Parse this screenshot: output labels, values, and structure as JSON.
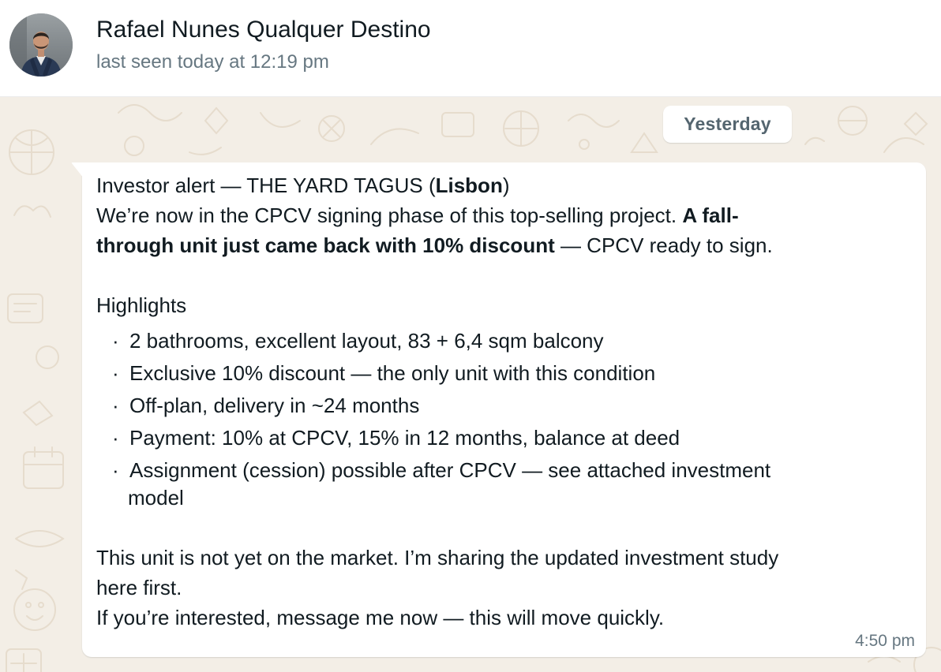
{
  "header": {
    "contact_name": "Rafael Nunes Qualquer Destino",
    "status": "last seen today at 12:19 pm"
  },
  "chat": {
    "date_divider": "Yesterday",
    "message": {
      "line1_a": "Investor alert — THE YARD TAGUS (",
      "line1_bold": "Lisbon",
      "line1_b": ")",
      "line2_a": "We’re now in the CPCV signing phase of this top-selling project. ",
      "line2_bold": "A fall-",
      "line3_bold": "through unit just came back with 10% discount",
      "line3_b": " — CPCV ready to sign.",
      "highlights_heading": "Highlights",
      "bullet_symbol": "·",
      "bullets": [
        "2 bathrooms, excellent layout, 83 + 6,4 sqm balcony",
        "Exclusive 10% discount — the only unit with this condition",
        "Off-plan, delivery in ~24 months",
        "Payment: 10% at CPCV, 15% in 12 months, balance at deed",
        "Assignment (cession) possible after CPCV — see attached investment"
      ],
      "bullet5_cont": "model",
      "closing1": "This unit is not yet on the market. I’m sharing the updated investment study",
      "closing2": "here first.",
      "closing3": "If you’re interested, message me now — this will move quickly.",
      "time": "4:50 pm"
    }
  },
  "colors": {
    "wallpaper": "#f3eee6",
    "bubble": "#ffffff",
    "secondary_text": "#667781",
    "primary_text": "#111b21"
  }
}
